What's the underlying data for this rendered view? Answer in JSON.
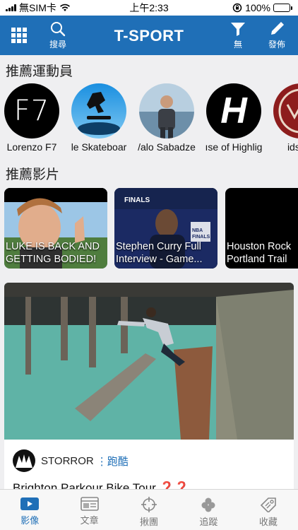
{
  "status_bar": {
    "carrier": "無SIM卡",
    "time": "上午2:33",
    "battery": "100%"
  },
  "header": {
    "title": "T-SPORT",
    "search_label": "搜尋",
    "filter_label": "無",
    "post_label": "發佈"
  },
  "athletes_section": {
    "title": "推薦運動員",
    "items": [
      {
        "name": "Lorenzo F7",
        "logo_text": "F7"
      },
      {
        "name": "le Skateboar"
      },
      {
        "name": "/alo Sabadze"
      },
      {
        "name": "ıse of Highlig",
        "logo_text": "H"
      },
      {
        "name": "ids Sk"
      }
    ]
  },
  "videos_section": {
    "title": "推薦影片",
    "items": [
      {
        "caption_line1": "LUKE IS BACK AND",
        "caption_line2": "GETTING BODIED!"
      },
      {
        "caption_line1": "Stephen Curry Full",
        "caption_line2": "Interview - Game...",
        "badge_top": "FINALS",
        "badge_side": "NBA FINALS"
      },
      {
        "caption_line1": "Houston Rock",
        "caption_line2": "Portland Trail"
      }
    ]
  },
  "feature": {
    "author": "STORROR",
    "category": "跑酷",
    "title": "Brighton Parkour Bike Tour ❓❓"
  },
  "tabbar": {
    "tabs": [
      {
        "label": "影像",
        "active": true
      },
      {
        "label": "文章",
        "active": false
      },
      {
        "label": "揪團",
        "active": false
      },
      {
        "label": "追蹤",
        "active": false
      },
      {
        "label": "收藏",
        "active": false
      }
    ]
  },
  "colors": {
    "brand_blue": "#1f6fb7",
    "battery_green": "#2fc440",
    "background": "#efeff1"
  }
}
